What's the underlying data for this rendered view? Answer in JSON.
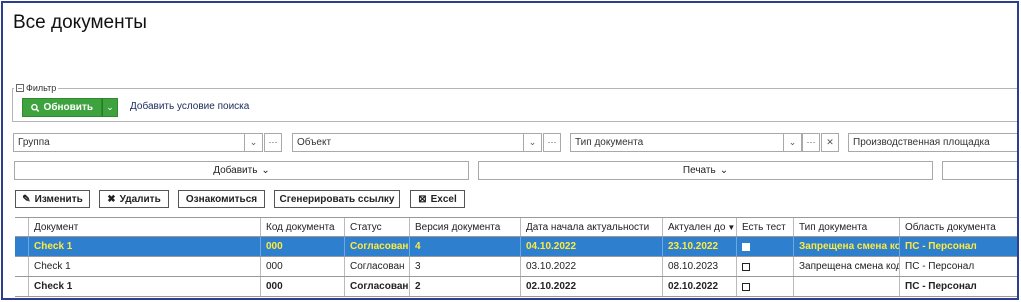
{
  "page": {
    "title": "Все документы"
  },
  "filter": {
    "legend": "Фильтр",
    "refresh_label": "Обновить",
    "add_condition": "Добавить условие поиска"
  },
  "combos": {
    "group": "Группа",
    "object": "Объект",
    "doc_type": "Тип документа",
    "site": "Производственная площадка"
  },
  "actions": {
    "add": "Добавить",
    "print": "Печать"
  },
  "toolbar": {
    "edit": "Изменить",
    "delete": "Удалить",
    "acquaint": "Ознакомиться",
    "gen_link": "Сгенерировать ссылку",
    "excel": "Excel"
  },
  "table": {
    "headers": [
      "Документ",
      "Код документа",
      "Статус",
      "Версия документа",
      "Дата начала актуальности",
      "Актуален до",
      "Есть тест",
      "Тип документа",
      "Область документа"
    ],
    "rows": [
      {
        "doc": "Check 1",
        "code": "000",
        "status": "Согласован",
        "version": "4",
        "start": "04.10.2022",
        "until": "23.10.2022",
        "type": "Запрещена смена кода",
        "area": "ПС - Персонал"
      },
      {
        "doc": "Check 1",
        "code": "000",
        "status": "Согласован",
        "version": "3",
        "start": "03.10.2022",
        "until": "08.10.2023",
        "type": "Запрещена смена кода",
        "area": "ПС - Персонал"
      },
      {
        "doc": "Check 1",
        "code": "000",
        "status": "Согласован",
        "version": "2",
        "start": "02.10.2022",
        "until": "02.10.2022",
        "type": "",
        "area": "ПС - Персонал"
      }
    ]
  },
  "colors": {
    "accent_green": "#3ea33e",
    "selection_blue": "#2f7fcf",
    "selection_text": "#ffeb3b",
    "frame_border": "#2b3f8e"
  }
}
